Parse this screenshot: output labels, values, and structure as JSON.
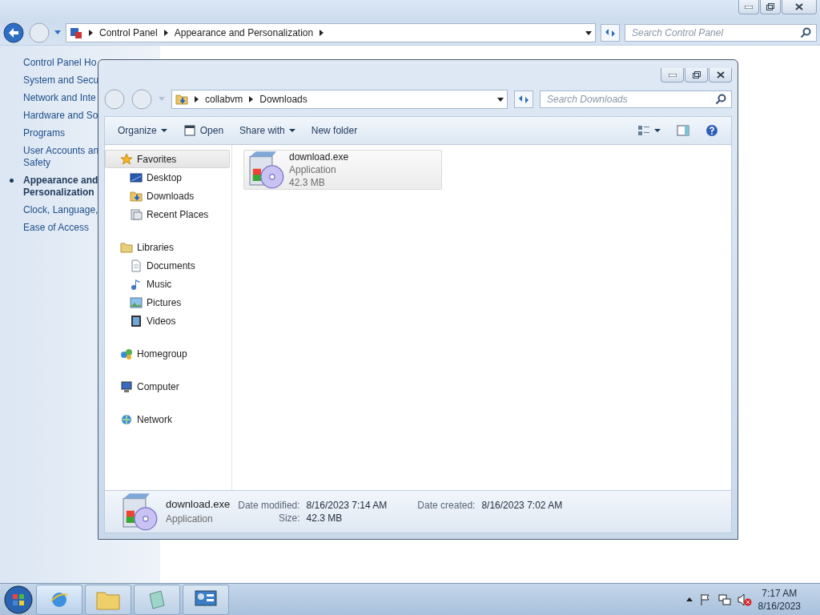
{
  "control_panel": {
    "breadcrumb": [
      "Control Panel",
      "Appearance and Personalization"
    ],
    "search": {
      "placeholder": "Search Control Panel"
    },
    "sidebar": [
      {
        "lines": [
          "Control Panel Ho"
        ],
        "selected": false
      },
      {
        "lines": [
          "System and Secu"
        ],
        "selected": false
      },
      {
        "lines": [
          "Network and Inte"
        ],
        "selected": false
      },
      {
        "lines": [
          "Hardware and So"
        ],
        "selected": false
      },
      {
        "lines": [
          "Programs"
        ],
        "selected": false
      },
      {
        "lines": [
          "User Accounts an",
          "Safety"
        ],
        "selected": false
      },
      {
        "lines": [
          "Appearance and",
          "Personalization"
        ],
        "selected": true
      },
      {
        "lines": [
          "Clock, Language,"
        ],
        "selected": false
      },
      {
        "lines": [
          "Ease of Access"
        ],
        "selected": false
      }
    ]
  },
  "explorer": {
    "breadcrumb": [
      "collabvm",
      "Downloads"
    ],
    "search": {
      "placeholder": "Search Downloads"
    },
    "toolbar": [
      {
        "label": "Organize",
        "kind": "menu"
      },
      {
        "label": "Open",
        "kind": "icon"
      },
      {
        "label": "Share with",
        "kind": "menu"
      },
      {
        "label": "New folder",
        "kind": "plain"
      }
    ],
    "nav": [
      {
        "label": "Favorites",
        "selected": true,
        "children": [
          {
            "label": "Desktop",
            "selected": false
          },
          {
            "label": "Downloads",
            "selected": false
          },
          {
            "label": "Recent Places",
            "selected": false
          }
        ]
      },
      {
        "label": "Libraries",
        "selected": false,
        "children": [
          {
            "label": "Documents",
            "selected": false
          },
          {
            "label": "Music",
            "selected": false
          },
          {
            "label": "Pictures",
            "selected": false
          },
          {
            "label": "Videos",
            "selected": false
          }
        ]
      },
      {
        "label": "Homegroup",
        "selected": false
      },
      {
        "label": "Computer",
        "selected": false
      },
      {
        "label": "Network",
        "selected": false
      }
    ],
    "files": [
      {
        "name": "download.exe",
        "type": "Application",
        "size": "42.3 MB",
        "selected": true
      }
    ],
    "details": {
      "name": "download.exe",
      "type": "Application",
      "fields": [
        {
          "label": "Date modified:",
          "value": "8/16/2023 7:14 AM"
        },
        {
          "label": "Date created:",
          "value": "8/16/2023 7:02 AM"
        },
        {
          "label": "Size:",
          "value": "42.3 MB"
        }
      ]
    }
  },
  "taskbar": {
    "time": "7:17 AM",
    "date": "8/16/2023"
  }
}
